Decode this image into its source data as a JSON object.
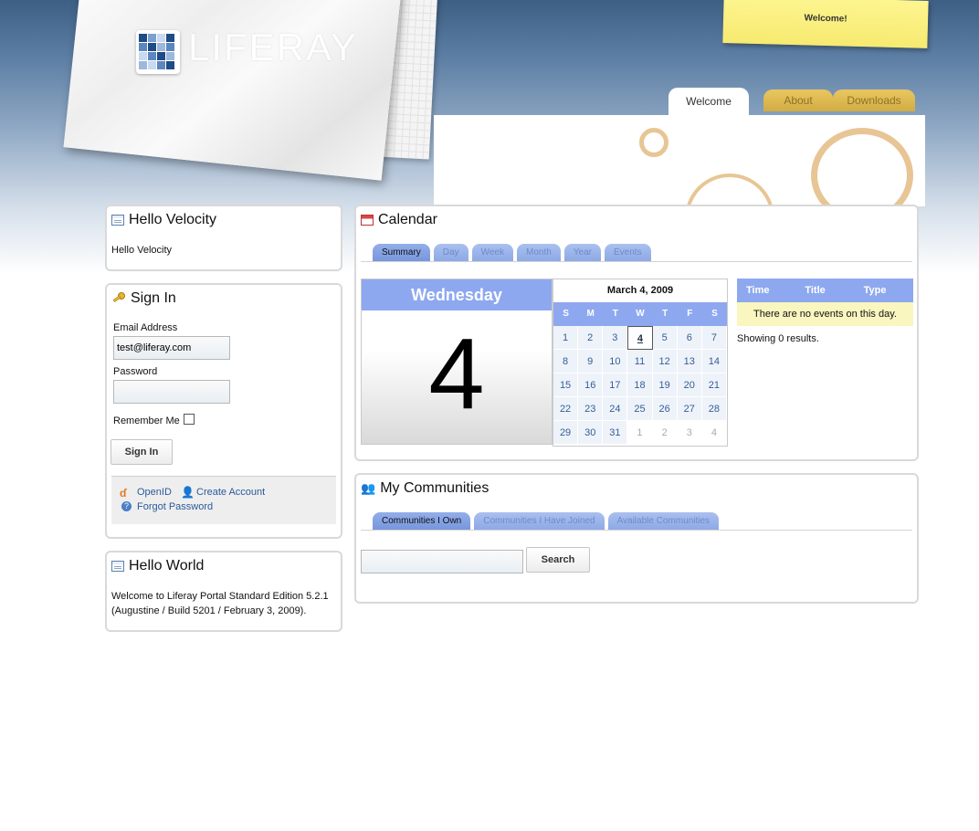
{
  "brand": {
    "name": "LIFERAY"
  },
  "sticky": {
    "text": "Welcome!"
  },
  "nav": {
    "tabs": [
      "Welcome",
      "About",
      "Downloads"
    ]
  },
  "hello_velocity": {
    "title": "Hello Velocity",
    "body": "Hello Velocity"
  },
  "sign_in": {
    "title": "Sign In",
    "email_label": "Email Address",
    "email_value": "test@liferay.com",
    "password_label": "Password",
    "remember_label": "Remember Me",
    "button_label": "Sign In",
    "links": {
      "openid": "OpenID",
      "create": "Create Account",
      "forgot": "Forgot Password"
    }
  },
  "hello_world": {
    "title": "Hello World",
    "line1": "Welcome to Liferay Portal Standard Edition 5.2.1",
    "line2": "(Augustine / Build 5201 / February 3, 2009)."
  },
  "calendar": {
    "title": "Calendar",
    "tabs": [
      "Summary",
      "Day",
      "Week",
      "Month",
      "Year",
      "Events"
    ],
    "selected_tab": "Summary",
    "day_name": "Wednesday",
    "day_number": "4",
    "month_title": "March 4, 2009",
    "dow": [
      "S",
      "M",
      "T",
      "W",
      "T",
      "F",
      "S"
    ],
    "weeks": [
      [
        "1",
        "2",
        "3",
        "4",
        "5",
        "6",
        "7"
      ],
      [
        "8",
        "9",
        "10",
        "11",
        "12",
        "13",
        "14"
      ],
      [
        "15",
        "16",
        "17",
        "18",
        "19",
        "20",
        "21"
      ],
      [
        "22",
        "23",
        "24",
        "25",
        "26",
        "27",
        "28"
      ],
      [
        "29",
        "30",
        "31",
        "1",
        "2",
        "3",
        "4"
      ]
    ],
    "today": "4",
    "event_columns": [
      "Time",
      "Title",
      "Type"
    ],
    "no_events": "There are no events on this day.",
    "results": "Showing 0 results."
  },
  "communities": {
    "title": "My Communities",
    "tabs": [
      "Communities I Own",
      "Communities I Have Joined",
      "Available Communities"
    ],
    "selected_tab": "Communities I Own",
    "search_value": "",
    "search_button": "Search"
  }
}
